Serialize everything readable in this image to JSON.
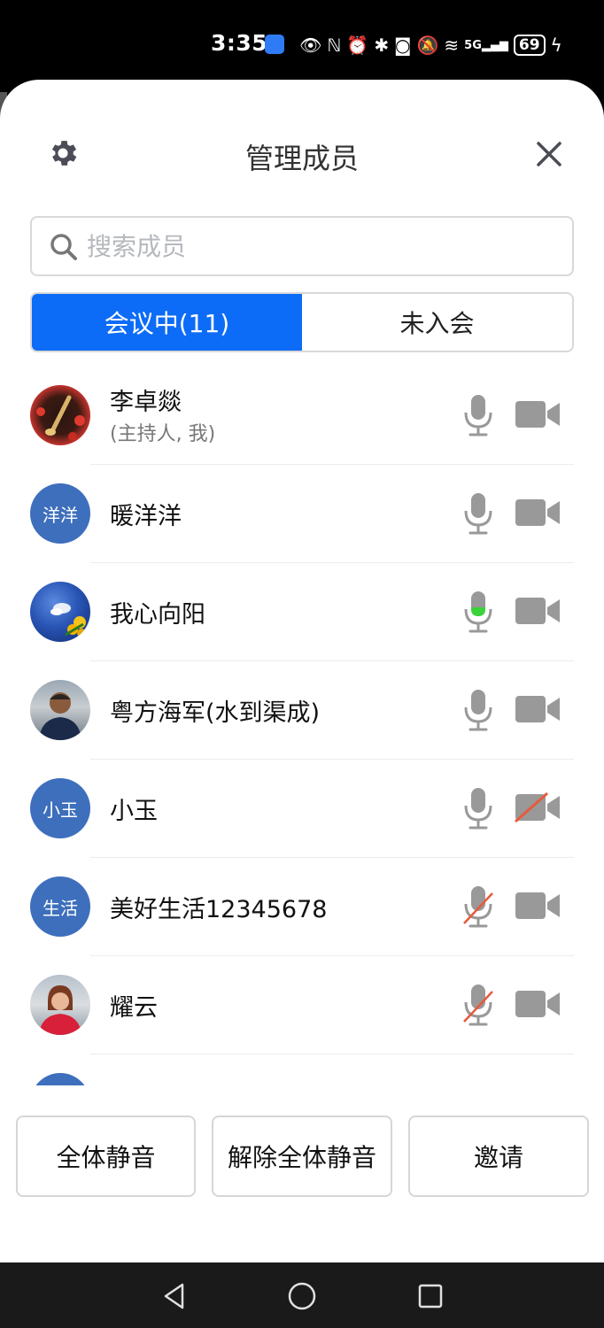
{
  "status_bar": {
    "time": "3:35",
    "battery": "69",
    "network": "5G"
  },
  "header": {
    "title": "管理成员"
  },
  "search": {
    "placeholder": "搜索成员"
  },
  "tabs": [
    {
      "label": "会议中(11)",
      "active": true
    },
    {
      "label": "未入会",
      "active": false
    }
  ],
  "members": [
    {
      "name": "李卓燚",
      "subtitle": "(主持人, 我)",
      "avatar_text": "",
      "mic": "on",
      "camera": "on"
    },
    {
      "name": "暖洋洋",
      "subtitle": "",
      "avatar_text": "洋洋",
      "mic": "on",
      "camera": "on"
    },
    {
      "name": "我心向阳",
      "subtitle": "",
      "avatar_text": "",
      "mic": "speaking",
      "camera": "on"
    },
    {
      "name": "粤方海军(水到渠成)",
      "subtitle": "",
      "avatar_text": "",
      "mic": "on",
      "camera": "on"
    },
    {
      "name": "小玉",
      "subtitle": "",
      "avatar_text": "小玉",
      "mic": "on",
      "camera": "off"
    },
    {
      "name": "美好生活12345678",
      "subtitle": "",
      "avatar_text": "生活",
      "mic": "muted",
      "camera": "on"
    },
    {
      "name": "耀云",
      "subtitle": "",
      "avatar_text": "",
      "mic": "muted",
      "camera": "on"
    }
  ],
  "footer": {
    "mute_all": "全体静音",
    "unmute_all": "解除全体静音",
    "invite": "邀请"
  },
  "colors": {
    "accent": "#0d6cf7",
    "avatar_bg": "#3e6fbd",
    "icon_gray": "#999999",
    "muted_red": "#e8593c",
    "speaking_green": "#3ad33a"
  }
}
